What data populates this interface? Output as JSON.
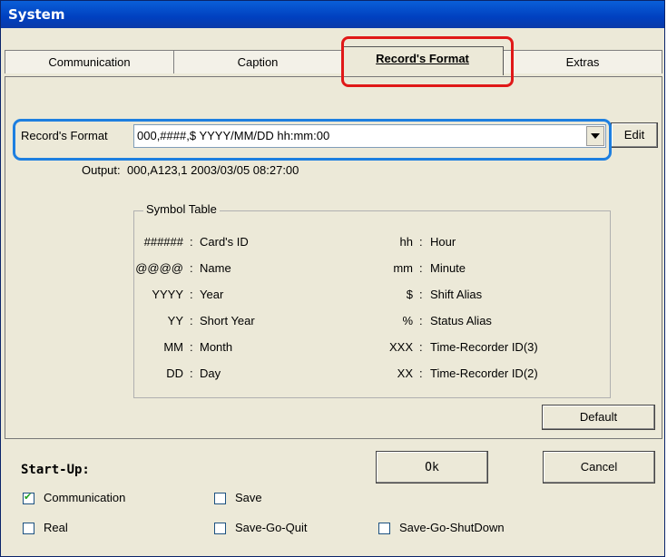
{
  "window": {
    "title": "System"
  },
  "tabs": [
    {
      "label": "Communication",
      "active": false
    },
    {
      "label": "Caption",
      "active": false
    },
    {
      "label": "Record's Format",
      "active": true
    },
    {
      "label": "Extras",
      "active": false
    }
  ],
  "record_format": {
    "label": "Record's Format",
    "value": "000,####,$ YYYY/MM/DD hh:mm:00",
    "edit_label": "Edit",
    "output_label": "Output:",
    "output_value": "000,A123,1 2003/03/05 08:27:00"
  },
  "symbol_table": {
    "title": "Symbol Table",
    "left": [
      {
        "symbol": "######",
        "desc": "Card's ID"
      },
      {
        "symbol": "@@@@",
        "desc": "Name"
      },
      {
        "symbol": "YYYY",
        "desc": "Year"
      },
      {
        "symbol": "YY",
        "desc": "Short Year"
      },
      {
        "symbol": "MM",
        "desc": "Month"
      },
      {
        "symbol": "DD",
        "desc": "Day"
      }
    ],
    "right": [
      {
        "symbol": "hh",
        "desc": "Hour"
      },
      {
        "symbol": "mm",
        "desc": "Minute"
      },
      {
        "symbol": "$",
        "desc": "Shift Alias"
      },
      {
        "symbol": "%",
        "desc": "Status Alias"
      },
      {
        "symbol": "XXX",
        "desc": "Time-Recorder ID(3)"
      },
      {
        "symbol": "XX",
        "desc": "Time-Recorder ID(2)"
      }
    ],
    "separator": ":"
  },
  "buttons": {
    "default": "Default",
    "ok": "Ok",
    "cancel": "Cancel"
  },
  "startup": {
    "title": "Start-Up:",
    "options": [
      {
        "label": "Communication",
        "checked": true
      },
      {
        "label": "Save",
        "checked": false
      },
      {
        "label": "Real",
        "checked": false
      },
      {
        "label": "Save-Go-Quit",
        "checked": false
      },
      {
        "label": "Save-Go-ShutDown",
        "checked": false
      }
    ]
  },
  "colors": {
    "highlight_red": "#e01818",
    "highlight_blue": "#1d7fe0",
    "titlebar": "#0040c0"
  }
}
